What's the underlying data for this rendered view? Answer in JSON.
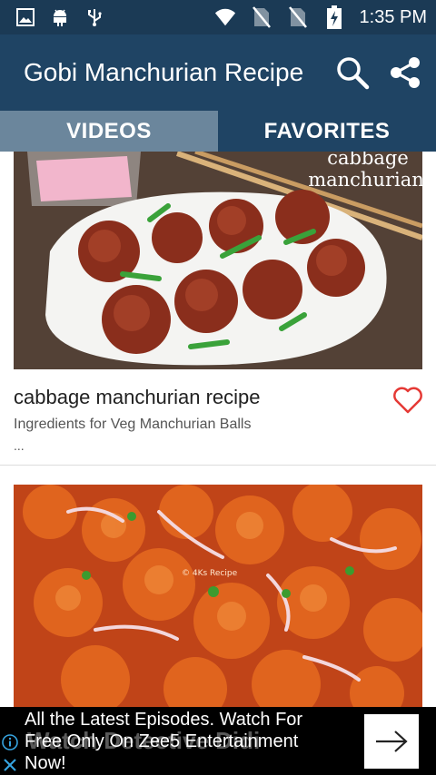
{
  "status_bar": {
    "time": "1:35 PM",
    "icons": [
      "image-icon",
      "android-icon",
      "usb-icon",
      "wifi-icon",
      "no-sim-icon",
      "no-sim-icon",
      "battery-charging-icon"
    ]
  },
  "app_bar": {
    "title": "Gobi Manchurian Recipe",
    "actions": [
      "search-icon",
      "share-icon"
    ]
  },
  "tabs": [
    {
      "label": "VIDEOS",
      "selected": true
    },
    {
      "label": "FAVORITES",
      "selected": false
    }
  ],
  "videos": [
    {
      "image_caption_line1": "cabbage",
      "image_caption_line2": "manchurian",
      "title": "cabbage manchurian recipe",
      "description": "Ingredients for Veg Manchurian Balls",
      "more": "...",
      "favorite_icon": "heart-outline-icon"
    },
    {
      "image_watermark": "© 4Ks Recipe"
    }
  ],
  "ad": {
    "text": "All the Latest Episodes. Watch For Free Only On Zee5 Entertainment Now!",
    "ghost_text": "Watch Detective Didi",
    "info_icon": "info-icon",
    "close_icon": "close-icon",
    "arrow_icon": "arrow-right-icon"
  },
  "colors": {
    "status_bar": "#1b3a55",
    "app_bar": "#1f4464",
    "tab_selected": "#6b869c",
    "heart": "#e53935"
  }
}
